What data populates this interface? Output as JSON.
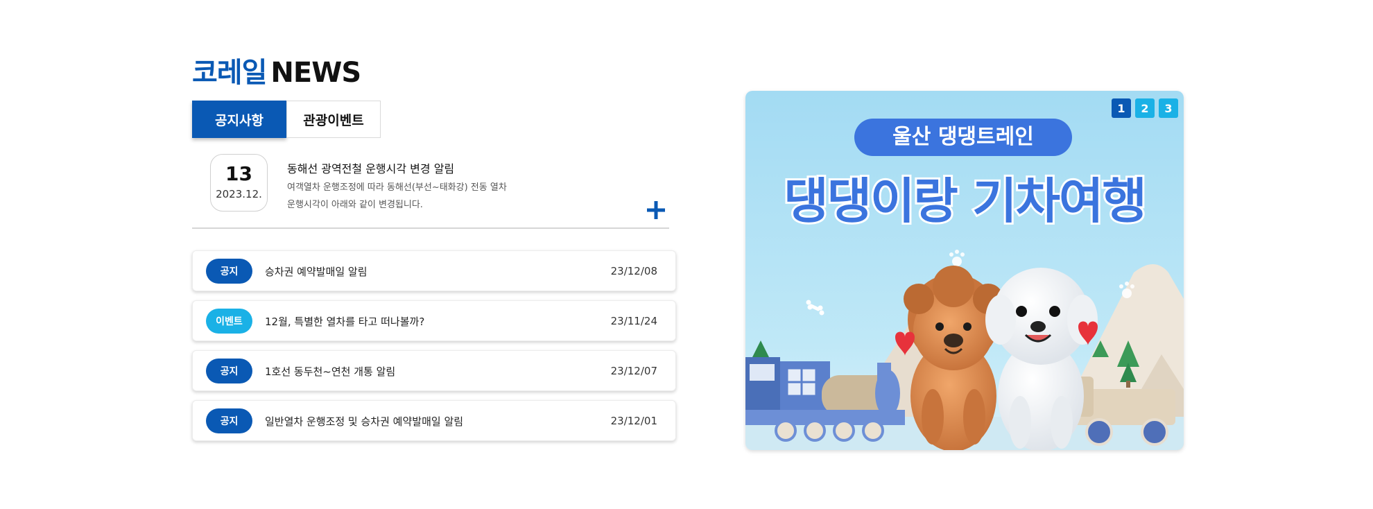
{
  "header": {
    "brand": "코레일",
    "title": "NEWS"
  },
  "tabs": [
    {
      "label": "공지사항",
      "active": true
    },
    {
      "label": "관광이벤트",
      "active": false
    }
  ],
  "featured": {
    "day": "13",
    "year_month": "2023.12.",
    "title": "동해선 광역전철 운행시각 변경 알림",
    "description_line1": "여객열차 운행조정에 따라 동해선(부선~태화강) 전동 열차",
    "description_line2": "운행시각이 아래와 같이 변경됩니다.",
    "more_icon": "plus-icon"
  },
  "news": [
    {
      "badge": "공지",
      "badge_color": "#0a59b4",
      "title": "승차권 예약발매일 알림",
      "date": "23/12/08"
    },
    {
      "badge": "이벤트",
      "badge_color": "#1ab1e6",
      "title": "12월, 특별한 열차를 타고 떠나볼까?",
      "date": "23/11/24"
    },
    {
      "badge": "공지",
      "badge_color": "#0a59b4",
      "title": "1호선 동두천~연천 개통 알림",
      "date": "23/12/07"
    },
    {
      "badge": "공지",
      "badge_color": "#0a59b4",
      "title": "일반열차 운행조정 및 승차권 예약발매일 알림",
      "date": "23/12/01"
    }
  ],
  "banner": {
    "subtitle": "울산 댕댕트레인",
    "title": "댕댕이랑 기차여행",
    "pager": [
      {
        "label": "1",
        "active": true
      },
      {
        "label": "2",
        "active": false
      },
      {
        "label": "3",
        "active": false
      }
    ]
  },
  "colors": {
    "primary": "#0a59b4",
    "event": "#1ab1e6",
    "pager_active": "#0a59b4",
    "pager_inactive": "#1ab1e6",
    "banner_sky": "#a9dff2",
    "banner_title": "#3b74de"
  }
}
